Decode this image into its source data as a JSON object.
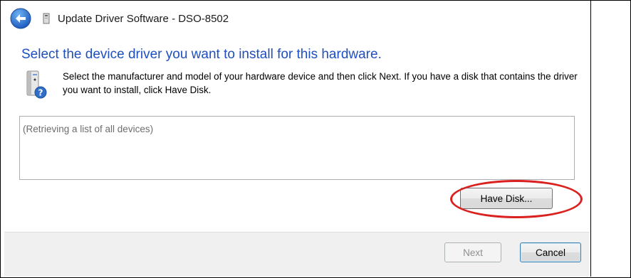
{
  "window": {
    "title": "Update Driver Software - DSO-8502"
  },
  "heading": "Select the device driver you want to install for this hardware.",
  "instructions": "Select the manufacturer and model of your hardware device and then click Next. If you have a disk that contains the driver you want to install, click Have Disk.",
  "device_list": {
    "status_text": "(Retrieving a list of all devices)"
  },
  "buttons": {
    "have_disk": "Have Disk...",
    "next": "Next",
    "cancel": "Cancel"
  },
  "annotation": {
    "highlight_color": "#d9211f"
  },
  "colors": {
    "heading_blue": "#1f4fbf",
    "back_button_blue": "#2b6fce"
  },
  "icons": {
    "back": "back-arrow-icon",
    "title": "device-icon",
    "info": "computer-help-icon"
  }
}
